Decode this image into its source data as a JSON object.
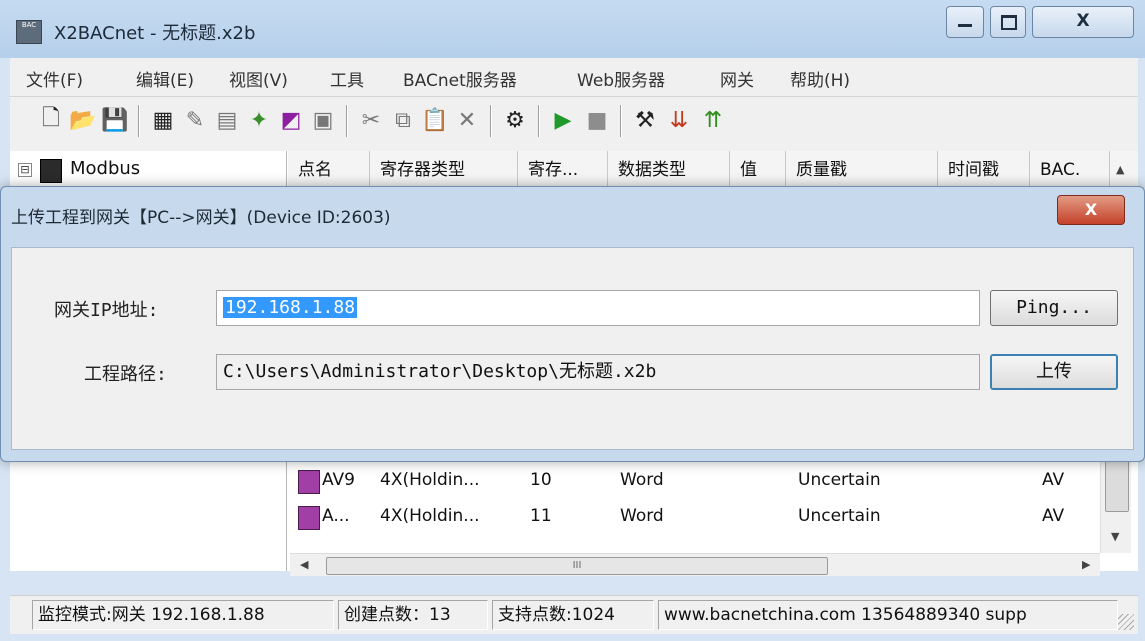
{
  "window": {
    "title": "X2BACnet - 无标题.x2b",
    "icon_text": "BAC",
    "minimize_glyph": "▁",
    "maximize_glyph": "□",
    "close_glyph": "X"
  },
  "menu": [
    "文件(F)",
    "编辑(E)",
    "视图(V)",
    "工具",
    "BACnet服务器",
    "Web服务器",
    "网关",
    "帮助(H)"
  ],
  "toolbar_icons": [
    {
      "name": "new-file-icon",
      "glyph": "🗋"
    },
    {
      "name": "open-folder-icon",
      "glyph": "📂"
    },
    {
      "name": "save-icon",
      "glyph": "💾"
    },
    {
      "name": "modbus-device-icon",
      "glyph": "▦"
    },
    {
      "name": "add-point-icon",
      "glyph": "✎"
    },
    {
      "name": "table-icon",
      "glyph": "▤"
    },
    {
      "name": "new-device-icon",
      "glyph": "✦"
    },
    {
      "name": "digital-icon",
      "glyph": "◩"
    },
    {
      "name": "properties-icon",
      "glyph": "▣"
    },
    {
      "name": "cut-icon",
      "glyph": "✂"
    },
    {
      "name": "copy-icon",
      "glyph": "⧉"
    },
    {
      "name": "paste-icon",
      "glyph": "📋"
    },
    {
      "name": "delete-icon",
      "glyph": "✕"
    },
    {
      "name": "build-icon",
      "glyph": "⚙"
    },
    {
      "name": "run-icon",
      "glyph": "▶"
    },
    {
      "name": "stop-icon",
      "glyph": "■"
    },
    {
      "name": "tools-icon",
      "glyph": "⚒"
    },
    {
      "name": "load-icon",
      "glyph": "⇊"
    },
    {
      "name": "upload-icon",
      "glyph": "⇈"
    }
  ],
  "tree": {
    "expander": "⊟",
    "root_label": "Modbus"
  },
  "table": {
    "headers": [
      "点名",
      "寄存器类型",
      "寄存...",
      "数据类型",
      "值",
      "质量戳",
      "时间戳",
      "BAC."
    ],
    "rows": [
      [
        "AV9",
        "4X(Holdin...",
        "10",
        "Word",
        "",
        "Uncertain",
        "",
        "AV"
      ],
      [
        "A...",
        "4X(Holdin...",
        "11",
        "Word",
        "",
        "Uncertain",
        "",
        "AV"
      ]
    ],
    "hscroll_grip": "III"
  },
  "status": {
    "panels": [
      "监控模式:网关 192.168.1.88",
      "创建点数：13",
      "支持点数:1024",
      "www.bacnetchina.com 13564889340 supp"
    ]
  },
  "dialog": {
    "title": "上传工程到网关【PC-->网关】(Device ID:2603)",
    "close_glyph": "X",
    "ip_label": "网关IP地址:",
    "ip_value": "192.168.1.88",
    "ping_label": "Ping...",
    "path_label": "工程路径:",
    "path_value": "C:\\Users\\Administrator\\Desktop\\无标题.x2b",
    "upload_label": "上传"
  },
  "colors": {
    "selection": "#3399ff",
    "dialog_frame": "#c7d9ec",
    "close_button": "#c4412a"
  }
}
